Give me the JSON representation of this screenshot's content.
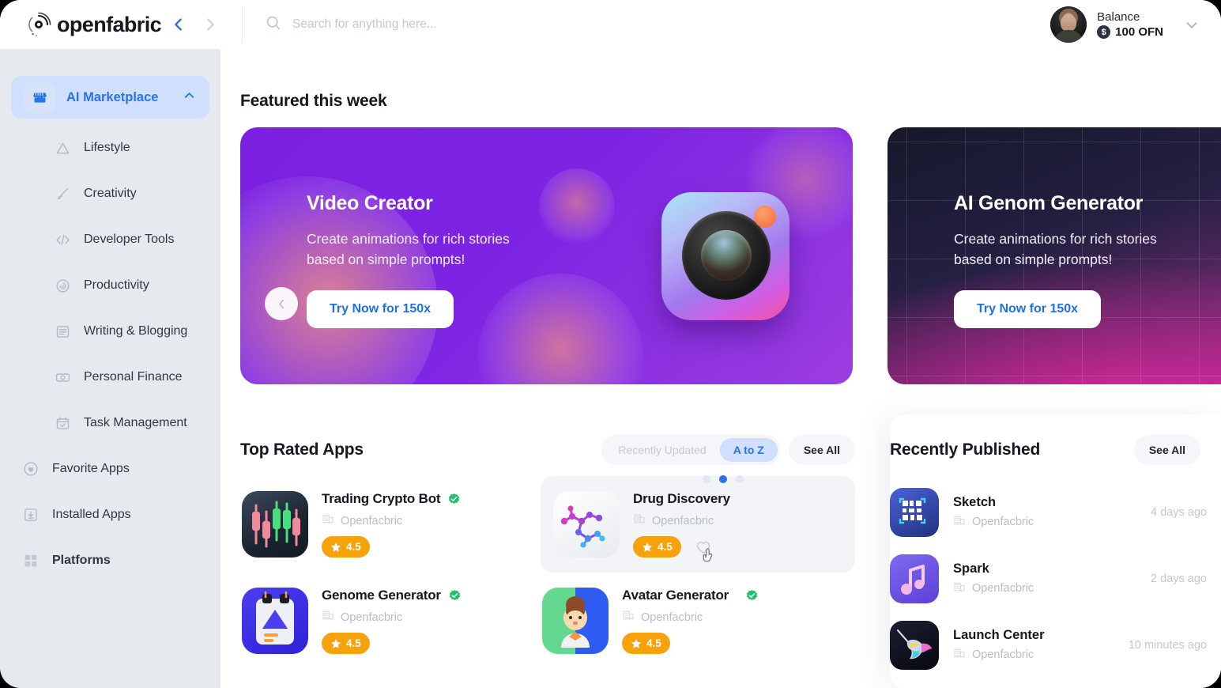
{
  "header": {
    "brand_name": "openfabric",
    "logo_icon": "openfabric-logo-icon",
    "back_icon": "chevron-left-icon",
    "forward_icon": "chevron-right-icon",
    "search": {
      "placeholder": "Search for anything here...",
      "value": "",
      "icon": "search-icon"
    },
    "profile": {
      "balance_label": "Balance",
      "balance_amount": "100 OFN",
      "coin_symbol": "$",
      "avatar_icon": "user-avatar",
      "chevron_icon": "chevron-down-icon"
    }
  },
  "sidebar": {
    "primary": {
      "label": "AI Marketplace",
      "icon": "storefront-icon",
      "collapse_icon": "chevron-up-icon",
      "active": true
    },
    "sub_items": [
      {
        "label": "Lifestyle",
        "icon": "mountain-icon"
      },
      {
        "label": "Creativity",
        "icon": "paintbrush-icon"
      },
      {
        "label": "Developer Tools",
        "icon": "code-brackets-icon"
      },
      {
        "label": "Productivity",
        "icon": "clock-icon"
      },
      {
        "label": "Writing & Blogging",
        "icon": "article-icon"
      },
      {
        "label": "Personal Finance",
        "icon": "banknote-icon"
      },
      {
        "label": "Task Management",
        "icon": "calendar-check-icon"
      }
    ],
    "root_items": [
      {
        "label": "Favorite Apps",
        "icon": "heart-circle-icon",
        "bold": false
      },
      {
        "label": "Installed Apps",
        "icon": "download-box-icon",
        "bold": false
      },
      {
        "label": "Platforms",
        "icon": "grid-squares-icon",
        "bold": true
      }
    ]
  },
  "featured": {
    "title": "Featured this week",
    "prev_icon": "chevron-left-icon",
    "next_icon": "pointer-hand-icon",
    "slides": [
      {
        "title": "Video Creator",
        "subtitle": "Create animations for rich stories based on simple prompts!",
        "cta": "Try Now for 150x",
        "art_icon": "camera-app-icon"
      },
      {
        "title": "AI Genom Generator",
        "subtitle": "Create animations for rich stories based on simple prompts!",
        "cta": "Try Now for 150x",
        "art_icon": "gem-icon"
      }
    ],
    "dots": [
      {
        "active": false
      },
      {
        "active": true
      },
      {
        "active": false
      }
    ]
  },
  "top_rated": {
    "title": "Top Rated Apps",
    "filters": [
      {
        "label": "Recently Updated",
        "active": false
      },
      {
        "label": "A to Z",
        "active": true
      }
    ],
    "see_all": "See All",
    "apps": [
      {
        "name": "Trading Crypto Bot",
        "publisher": "Openfacbric",
        "rating": "4.5",
        "verified": true,
        "icon": "trading-crypto-bot-icon",
        "hovered": false
      },
      {
        "name": "Drug Discovery",
        "publisher": "Openfacbric",
        "rating": "4.5",
        "verified": false,
        "icon": "drug-discovery-icon",
        "hovered": true
      },
      {
        "name": "Genome Generator",
        "publisher": "Openfacbric",
        "rating": "4.5",
        "verified": true,
        "icon": "genome-generator-icon",
        "hovered": false
      },
      {
        "name": "Avatar Generator",
        "publisher": "Openfacbric",
        "rating": "4.5",
        "verified": true,
        "icon": "avatar-generator-icon",
        "hovered": false
      }
    ]
  },
  "recently_published": {
    "title": "Recently Published",
    "see_all": "See All",
    "items": [
      {
        "name": "Sketch",
        "publisher": "Openfacbric",
        "time": "4 days ago",
        "icon": "sketch-icon"
      },
      {
        "name": "Spark",
        "publisher": "Openfacbric",
        "time": "2 days ago",
        "icon": "spark-icon"
      },
      {
        "name": "Launch Center",
        "publisher": "Openfacbric",
        "time": "10 minutes ago",
        "icon": "launch-center-icon"
      }
    ]
  },
  "colors": {
    "accent_blue": "#2a72f0",
    "sidebar_bg": "#e6e9ee",
    "rating_amber": "#f5a20b",
    "verified_green": "#1fc16b",
    "slide_purple": "#7b1fe0"
  }
}
